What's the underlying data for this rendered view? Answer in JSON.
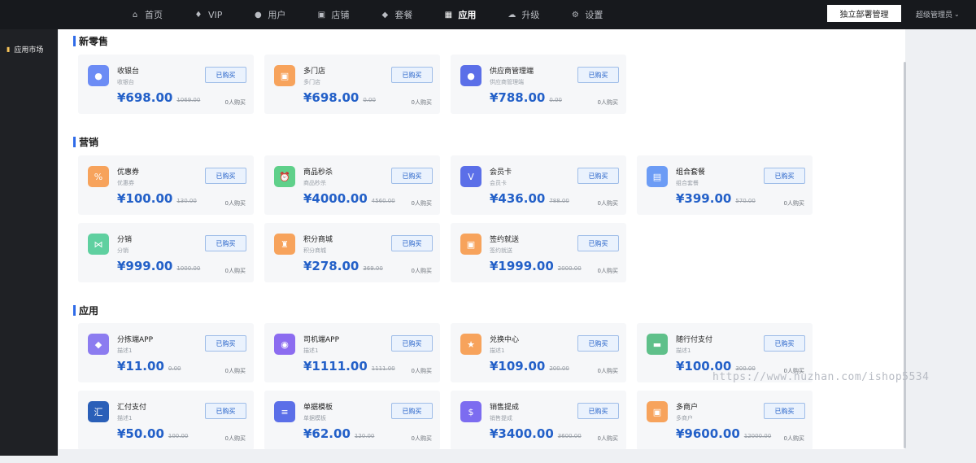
{
  "nav": {
    "items": [
      {
        "label": "首页",
        "icon": "home-icon",
        "glyph": "⌂"
      },
      {
        "label": "VIP",
        "icon": "location-icon",
        "glyph": "♦"
      },
      {
        "label": "用户",
        "icon": "user-icon",
        "glyph": "●"
      },
      {
        "label": "店铺",
        "icon": "store-icon",
        "glyph": "▣"
      },
      {
        "label": "套餐",
        "icon": "package-icon",
        "glyph": "◆"
      },
      {
        "label": "应用",
        "icon": "grid-icon",
        "glyph": "▦",
        "active": true
      },
      {
        "label": "升级",
        "icon": "cloud-upload-icon",
        "glyph": "☁"
      },
      {
        "label": "设置",
        "icon": "gear-icon",
        "glyph": "⚙"
      }
    ],
    "deploy_label": "独立部署管理",
    "admin_label": "超级管理员"
  },
  "sidebar": {
    "item_label": "应用市场",
    "icon": "app-market-icon"
  },
  "buy_label": "已购买",
  "sections": [
    {
      "title": "新零售",
      "cards": [
        {
          "name": "收银台",
          "desc": "收银台",
          "price": "¥698.00",
          "old": "1069.00",
          "buyers": "0人购买",
          "icon": "cashier-icon",
          "color": "#6c8cf5",
          "glyph": "●"
        },
        {
          "name": "多门店",
          "desc": "多门店",
          "price": "¥698.00",
          "old": "0.00",
          "buyers": "0人购买",
          "icon": "multi-store-icon",
          "color": "#f7a35c",
          "glyph": "▣"
        },
        {
          "name": "供应商管理端",
          "desc": "供应商管理端",
          "price": "¥788.00",
          "old": "0.00",
          "buyers": "0人购买",
          "icon": "supplier-icon",
          "color": "#5b6fe8",
          "glyph": "●"
        }
      ]
    },
    {
      "title": "营销",
      "cards": [
        {
          "name": "优惠券",
          "desc": "优惠券",
          "price": "¥100.00",
          "old": "130.00",
          "buyers": "0人购买",
          "icon": "coupon-icon",
          "color": "#f7a35c",
          "glyph": "%"
        },
        {
          "name": "商品秒杀",
          "desc": "商品秒杀",
          "price": "¥4000.00",
          "old": "4560.00",
          "buyers": "0人购买",
          "icon": "flash-sale-icon",
          "color": "#5fd08a",
          "glyph": "⏰"
        },
        {
          "name": "会员卡",
          "desc": "会员卡",
          "price": "¥436.00",
          "old": "788.00",
          "buyers": "0人购买",
          "icon": "member-card-icon",
          "color": "#5b6fe8",
          "glyph": "V"
        },
        {
          "name": "组合套餐",
          "desc": "组合套餐",
          "price": "¥399.00",
          "old": "570.00",
          "buyers": "0人购买",
          "icon": "combo-icon",
          "color": "#6c9cf5",
          "glyph": "▤"
        },
        {
          "name": "分销",
          "desc": "分销",
          "price": "¥999.00",
          "old": "1000.00",
          "buyers": "0人购买",
          "icon": "distribution-icon",
          "color": "#5fd0a0",
          "glyph": "⋈"
        },
        {
          "name": "积分商城",
          "desc": "积分商城",
          "price": "¥278.00",
          "old": "369.00",
          "buyers": "0人购买",
          "icon": "points-mall-icon",
          "color": "#f7a35c",
          "glyph": "♜"
        },
        {
          "name": "签约就送",
          "desc": "签约就送",
          "price": "¥1999.00",
          "old": "2000.00",
          "buyers": "0人购买",
          "icon": "sign-gift-icon",
          "color": "#f7a35c",
          "glyph": "▣"
        }
      ]
    },
    {
      "title": "应用",
      "cards": [
        {
          "name": "分拣端APP",
          "desc": "描述1",
          "price": "¥11.00",
          "old": "0.00",
          "buyers": "0人购买",
          "icon": "sorting-app-icon",
          "color": "#8c7cf0",
          "glyph": "◆"
        },
        {
          "name": "司机端APP",
          "desc": "描述1",
          "price": "¥1111.00",
          "old": "1111.00",
          "buyers": "0人购买",
          "icon": "driver-app-icon",
          "color": "#8c6cf0",
          "glyph": "◉"
        },
        {
          "name": "兑换中心",
          "desc": "描述1",
          "price": "¥109.00",
          "old": "200.00",
          "buyers": "0人购买",
          "icon": "exchange-icon",
          "color": "#f7a35c",
          "glyph": "★"
        },
        {
          "name": "随行付支付",
          "desc": "描述1",
          "price": "¥100.00",
          "old": "300.00",
          "buyers": "0人购买",
          "icon": "suixingfu-pay-icon",
          "color": "#5fc08a",
          "glyph": "▬"
        },
        {
          "name": "汇付支付",
          "desc": "描述1",
          "price": "¥50.00",
          "old": "100.00",
          "buyers": "0人购买",
          "icon": "huifu-pay-icon",
          "color": "#2a5fb8",
          "glyph": "汇"
        },
        {
          "name": "单据模板",
          "desc": "单据模板",
          "price": "¥62.00",
          "old": "120.00",
          "buyers": "0人购买",
          "icon": "document-template-icon",
          "color": "#5b6fe8",
          "glyph": "≡"
        },
        {
          "name": "销售提成",
          "desc": "销售提成",
          "price": "¥3400.00",
          "old": "3600.00",
          "buyers": "0人购买",
          "icon": "sales-commission-icon",
          "color": "#7c6cf0",
          "glyph": "$"
        },
        {
          "name": "多商户",
          "desc": "多商户",
          "price": "¥9600.00",
          "old": "12000.00",
          "buyers": "0人购买",
          "icon": "multi-merchant-icon",
          "color": "#f7a35c",
          "glyph": "▣"
        }
      ]
    }
  ],
  "watermark": "https://www.huzhan.com/ishop5534"
}
